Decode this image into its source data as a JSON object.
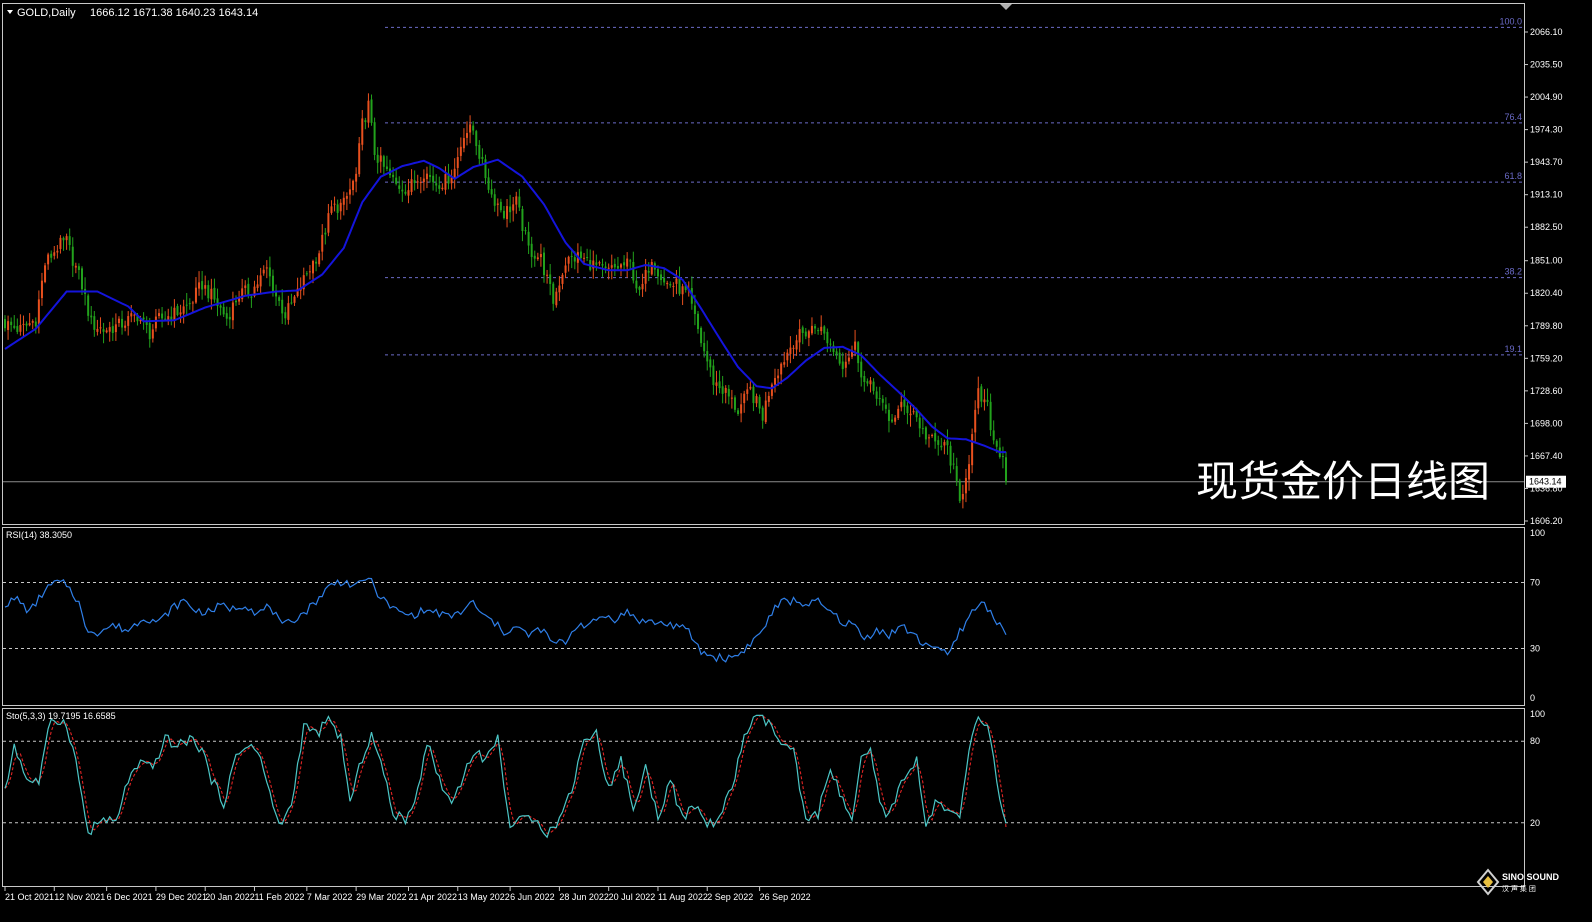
{
  "header": {
    "symbol": "GOLD,Daily",
    "ohlc": "1666.12 1671.38 1640.23 1643.14"
  },
  "watermark": "现货金价日线图",
  "logo": {
    "text": "SINO SOUND",
    "sub": "汉  声  集  团"
  },
  "colors": {
    "background": "#000000",
    "up_candle": "#e8501e",
    "down_candle": "#22a21c",
    "ma": "#1414dc",
    "fib": "#6b6bc8",
    "rsi": "#2f7fe8",
    "sto_main": "#4cc6c6",
    "sto_signal": "#e02424",
    "text": "#ffffff"
  },
  "chart_data": [
    {
      "type": "candlestick",
      "name": "price",
      "ylim": [
        1606.2,
        2066.1
      ],
      "y_ticks": [
        "2066.10",
        "2035.50",
        "2004.90",
        "1974.30",
        "1943.70",
        "1913.10",
        "1882.50",
        "1851.00",
        "1820.40",
        "1789.80",
        "1759.20",
        "1728.60",
        "1698.00",
        "1667.40",
        "1636.80",
        "1606.20"
      ],
      "current_price": "1643.14",
      "fibonacci": [
        {
          "label": "100.0",
          "value": 2070.5
        },
        {
          "label": "76.4",
          "value": 1980.6
        },
        {
          "label": "61.8",
          "value": 1924.9
        },
        {
          "label": "38.2",
          "value": 1835.1
        },
        {
          "label": "19.1",
          "value": 1762.4
        }
      ],
      "moving_average_anchors": [
        [
          0,
          1768
        ],
        [
          10,
          1787
        ],
        [
          20,
          1822
        ],
        [
          30,
          1822
        ],
        [
          40,
          1808
        ],
        [
          45,
          1794
        ],
        [
          55,
          1795
        ],
        [
          65,
          1807
        ],
        [
          78,
          1818
        ],
        [
          88,
          1822
        ],
        [
          95,
          1823
        ],
        [
          103,
          1838
        ],
        [
          110,
          1863
        ],
        [
          116,
          1906
        ],
        [
          122,
          1930
        ],
        [
          129,
          1940
        ],
        [
          136,
          1945
        ],
        [
          141,
          1938
        ],
        [
          146,
          1928
        ],
        [
          152,
          1939
        ],
        [
          160,
          1946
        ],
        [
          168,
          1930
        ],
        [
          175,
          1904
        ],
        [
          182,
          1868
        ],
        [
          188,
          1848
        ],
        [
          196,
          1842
        ],
        [
          202,
          1842
        ],
        [
          208,
          1847
        ],
        [
          214,
          1844
        ],
        [
          220,
          1833
        ],
        [
          226,
          1806
        ],
        [
          232,
          1778
        ],
        [
          238,
          1751
        ],
        [
          244,
          1733
        ],
        [
          249,
          1731
        ],
        [
          254,
          1741
        ],
        [
          260,
          1757
        ],
        [
          266,
          1769
        ],
        [
          272,
          1770
        ],
        [
          278,
          1762
        ],
        [
          284,
          1744
        ],
        [
          290,
          1728
        ],
        [
          296,
          1711
        ],
        [
          301,
          1695
        ],
        [
          306,
          1684
        ],
        [
          312,
          1683
        ],
        [
          318,
          1677
        ],
        [
          323,
          1671
        ]
      ],
      "close_anchors": [
        [
          0,
          1792
        ],
        [
          5,
          1786
        ],
        [
          10,
          1796
        ],
        [
          13,
          1848
        ],
        [
          17,
          1864
        ],
        [
          20,
          1869
        ],
        [
          25,
          1828
        ],
        [
          28,
          1792
        ],
        [
          32,
          1786
        ],
        [
          37,
          1790
        ],
        [
          43,
          1800
        ],
        [
          47,
          1783
        ],
        [
          50,
          1796
        ],
        [
          55,
          1801
        ],
        [
          60,
          1810
        ],
        [
          64,
          1829
        ],
        [
          68,
          1814
        ],
        [
          72,
          1797
        ],
        [
          76,
          1820
        ],
        [
          80,
          1822
        ],
        [
          85,
          1843
        ],
        [
          88,
          1818
        ],
        [
          91,
          1800
        ],
        [
          95,
          1820
        ],
        [
          98,
          1839
        ],
        [
          102,
          1860
        ],
        [
          106,
          1900
        ],
        [
          110,
          1904
        ],
        [
          114,
          1931
        ],
        [
          116,
          1979
        ],
        [
          118,
          1997
        ],
        [
          120,
          1953
        ],
        [
          123,
          1938
        ],
        [
          127,
          1922
        ],
        [
          131,
          1919
        ],
        [
          136,
          1935
        ],
        [
          140,
          1924
        ],
        [
          143,
          1926
        ],
        [
          146,
          1937
        ],
        [
          149,
          1972
        ],
        [
          152,
          1974
        ],
        [
          155,
          1940
        ],
        [
          158,
          1913
        ],
        [
          162,
          1896
        ],
        [
          166,
          1906
        ],
        [
          170,
          1862
        ],
        [
          174,
          1853
        ],
        [
          178,
          1813
        ],
        [
          182,
          1850
        ],
        [
          186,
          1855
        ],
        [
          190,
          1849
        ],
        [
          195,
          1840
        ],
        [
          199,
          1845
        ],
        [
          203,
          1848
        ],
        [
          206,
          1818
        ],
        [
          210,
          1855
        ],
        [
          214,
          1830
        ],
        [
          218,
          1828
        ],
        [
          222,
          1817
        ],
        [
          226,
          1775
        ],
        [
          230,
          1738
        ],
        [
          234,
          1727
        ],
        [
          238,
          1710
        ],
        [
          242,
          1729
        ],
        [
          246,
          1705
        ],
        [
          249,
          1739
        ],
        [
          252,
          1754
        ],
        [
          256,
          1776
        ],
        [
          260,
          1784
        ],
        [
          264,
          1790
        ],
        [
          268,
          1772
        ],
        [
          272,
          1755
        ],
        [
          276,
          1771
        ],
        [
          279,
          1736
        ],
        [
          283,
          1727
        ],
        [
          287,
          1699
        ],
        [
          291,
          1713
        ],
        [
          295,
          1710
        ],
        [
          298,
          1690
        ],
        [
          302,
          1678
        ],
        [
          306,
          1675
        ],
        [
          308,
          1653
        ],
        [
          310,
          1623
        ],
        [
          313,
          1665
        ],
        [
          316,
          1725
        ],
        [
          319,
          1712
        ],
        [
          321,
          1682
        ],
        [
          323,
          1672
        ],
        [
          325,
          1666
        ]
      ],
      "last_candle": {
        "open": 1666.12,
        "high": 1671.38,
        "low": 1640.23,
        "close": 1643.14
      }
    },
    {
      "type": "line",
      "name": "RSI(14) 38.3050",
      "ylim": [
        0,
        100
      ],
      "y_ticks": [
        "100",
        "70",
        "30",
        "0"
      ],
      "levels": [
        70,
        30
      ],
      "value_anchors": [
        [
          0,
          57
        ],
        [
          4,
          60
        ],
        [
          8,
          52
        ],
        [
          12,
          63
        ],
        [
          16,
          70
        ],
        [
          20,
          69
        ],
        [
          24,
          58
        ],
        [
          26,
          42
        ],
        [
          30,
          40
        ],
        [
          35,
          44
        ],
        [
          40,
          41
        ],
        [
          45,
          49
        ],
        [
          50,
          46
        ],
        [
          54,
          54
        ],
        [
          58,
          59
        ],
        [
          62,
          53
        ],
        [
          66,
          52
        ],
        [
          70,
          56
        ],
        [
          74,
          54
        ],
        [
          78,
          57
        ],
        [
          82,
          51
        ],
        [
          86,
          56
        ],
        [
          90,
          43
        ],
        [
          94,
          48
        ],
        [
          98,
          53
        ],
        [
          102,
          61
        ],
        [
          106,
          69
        ],
        [
          110,
          71
        ],
        [
          114,
          67
        ],
        [
          118,
          74
        ],
        [
          120,
          66
        ],
        [
          124,
          57
        ],
        [
          128,
          52
        ],
        [
          132,
          50
        ],
        [
          136,
          53
        ],
        [
          140,
          52
        ],
        [
          144,
          49
        ],
        [
          148,
          52
        ],
        [
          152,
          58
        ],
        [
          155,
          50
        ],
        [
          158,
          47
        ],
        [
          162,
          40
        ],
        [
          166,
          43
        ],
        [
          170,
          38
        ],
        [
          174,
          42
        ],
        [
          178,
          33
        ],
        [
          182,
          34
        ],
        [
          186,
          45
        ],
        [
          190,
          44
        ],
        [
          194,
          50
        ],
        [
          198,
          48
        ],
        [
          202,
          52
        ],
        [
          206,
          47
        ],
        [
          210,
          46
        ],
        [
          214,
          45
        ],
        [
          218,
          44
        ],
        [
          222,
          40
        ],
        [
          226,
          28
        ],
        [
          230,
          25
        ],
        [
          234,
          24
        ],
        [
          238,
          26
        ],
        [
          242,
          33
        ],
        [
          246,
          41
        ],
        [
          249,
          52
        ],
        [
          252,
          58
        ],
        [
          256,
          59
        ],
        [
          260,
          57
        ],
        [
          264,
          58
        ],
        [
          268,
          52
        ],
        [
          272,
          46
        ],
        [
          276,
          44
        ],
        [
          279,
          35
        ],
        [
          283,
          42
        ],
        [
          287,
          38
        ],
        [
          291,
          44
        ],
        [
          295,
          38
        ],
        [
          298,
          33
        ],
        [
          302,
          32
        ],
        [
          306,
          25
        ],
        [
          310,
          40
        ],
        [
          314,
          52
        ],
        [
          317,
          58
        ],
        [
          320,
          53
        ],
        [
          322,
          46
        ],
        [
          324,
          44
        ],
        [
          325,
          38.3
        ]
      ]
    },
    {
      "type": "line",
      "name": "Sto(5,3,3) 19.7195 16.6585",
      "ylim": [
        0,
        100
      ],
      "y_ticks": [
        "100",
        "80",
        "20"
      ],
      "levels": [
        80,
        20
      ],
      "series": [
        {
          "name": "main",
          "last": 19.7195
        },
        {
          "name": "signal",
          "last": 16.6585
        }
      ],
      "main_anchors": [
        [
          0,
          42
        ],
        [
          3,
          78
        ],
        [
          7,
          52
        ],
        [
          11,
          50
        ],
        [
          15,
          97
        ],
        [
          20,
          93
        ],
        [
          23,
          65
        ],
        [
          27,
          12
        ],
        [
          31,
          22
        ],
        [
          36,
          20
        ],
        [
          40,
          52
        ],
        [
          44,
          63
        ],
        [
          48,
          60
        ],
        [
          52,
          82
        ],
        [
          56,
          76
        ],
        [
          60,
          82
        ],
        [
          64,
          74
        ],
        [
          67,
          52
        ],
        [
          71,
          35
        ],
        [
          75,
          68
        ],
        [
          79,
          79
        ],
        [
          83,
          68
        ],
        [
          86,
          40
        ],
        [
          89,
          18
        ],
        [
          93,
          32
        ],
        [
          97,
          92
        ],
        [
          101,
          85
        ],
        [
          105,
          95
        ],
        [
          109,
          83
        ],
        [
          112,
          34
        ],
        [
          116,
          68
        ],
        [
          119,
          85
        ],
        [
          122,
          64
        ],
        [
          126,
          28
        ],
        [
          130,
          20
        ],
        [
          134,
          45
        ],
        [
          137,
          80
        ],
        [
          141,
          52
        ],
        [
          145,
          34
        ],
        [
          149,
          56
        ],
        [
          152,
          72
        ],
        [
          156,
          67
        ],
        [
          160,
          82
        ],
        [
          164,
          17
        ],
        [
          168,
          22
        ],
        [
          172,
          25
        ],
        [
          176,
          12
        ],
        [
          180,
          22
        ],
        [
          184,
          45
        ],
        [
          188,
          82
        ],
        [
          192,
          85
        ],
        [
          196,
          45
        ],
        [
          200,
          66
        ],
        [
          204,
          30
        ],
        [
          208,
          60
        ],
        [
          212,
          24
        ],
        [
          216,
          52
        ],
        [
          220,
          22
        ],
        [
          224,
          33
        ],
        [
          228,
          18
        ],
        [
          232,
          24
        ],
        [
          236,
          45
        ],
        [
          240,
          84
        ],
        [
          244,
          98
        ],
        [
          248,
          93
        ],
        [
          252,
          78
        ],
        [
          256,
          72
        ],
        [
          260,
          20
        ],
        [
          264,
          27
        ],
        [
          268,
          62
        ],
        [
          272,
          35
        ],
        [
          275,
          22
        ],
        [
          278,
          65
        ],
        [
          281,
          72
        ],
        [
          284,
          35
        ],
        [
          287,
          24
        ],
        [
          290,
          45
        ],
        [
          293,
          54
        ],
        [
          296,
          68
        ],
        [
          299,
          18
        ],
        [
          302,
          34
        ],
        [
          305,
          30
        ],
        [
          308,
          26
        ],
        [
          310,
          22
        ],
        [
          313,
          75
        ],
        [
          316,
          96
        ],
        [
          319,
          93
        ],
        [
          321,
          65
        ],
        [
          323,
          35
        ],
        [
          325,
          19.7
        ]
      ]
    }
  ],
  "x_axis": {
    "candle_count": 326,
    "ticks": [
      {
        "label": "21 Oct 2021",
        "index": 0
      },
      {
        "label": "12 Nov 2021",
        "index": 16
      },
      {
        "label": "6 Dec 2021",
        "index": 33
      },
      {
        "label": "29 Dec 2021",
        "index": 49
      },
      {
        "label": "20 Jan 2022",
        "index": 65
      },
      {
        "label": "11 Feb 2022",
        "index": 81
      },
      {
        "label": "7 Mar 2022",
        "index": 98
      },
      {
        "label": "29 Mar 2022",
        "index": 114
      },
      {
        "label": "21 Apr 2022",
        "index": 131
      },
      {
        "label": "13 May 2022",
        "index": 147
      },
      {
        "label": "6 Jun 2022",
        "index": 164
      },
      {
        "label": "28 Jun 2022",
        "index": 180
      },
      {
        "label": "20 Jul 2022",
        "index": 196
      },
      {
        "label": "11 Aug 2022",
        "index": 212
      },
      {
        "label": "2 Sep 2022",
        "index": 228
      },
      {
        "label": "26 Sep 2022",
        "index": 245
      }
    ]
  }
}
